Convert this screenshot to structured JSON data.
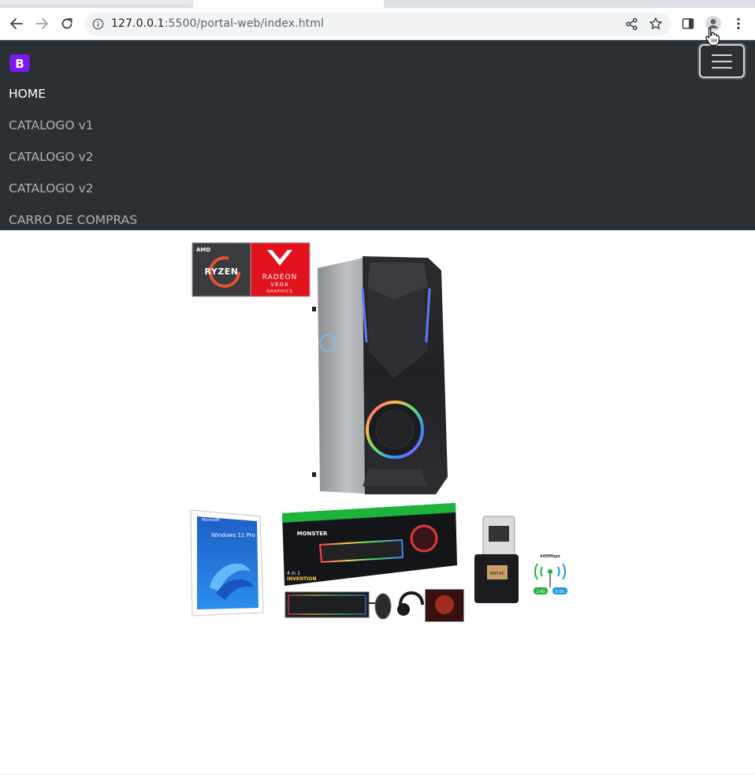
{
  "browser": {
    "url_host": "127.0.0.1",
    "url_path": ":5500/portal-web/index.html"
  },
  "navbar": {
    "brand_letter": "B",
    "items": [
      {
        "label": "HOME",
        "active": true
      },
      {
        "label": "CATALOGO v1",
        "active": false
      },
      {
        "label": "CATALOGO v2",
        "active": false
      },
      {
        "label": "CATALOGO v2",
        "active": false
      },
      {
        "label": "CARRO DE COMPRAS",
        "active": false
      }
    ]
  },
  "hero": {
    "badges": {
      "amd": "AMD",
      "ryzen": "RYZEN",
      "radeon": "RADEON",
      "vega": "VEGA",
      "graphics": "GRAPHICS"
    },
    "windows_label": "Windows 11 Pro",
    "microsoft_label": "Microsoft",
    "combo_brand": "MONSTER",
    "combo_subtitle": "4 in 1",
    "combo_sub2": "INVENTION",
    "wifi_speed": "600Mbps",
    "wifi_band1": "2.4G",
    "wifi_band2": "5.0G",
    "adapter_label": "WiFi AC"
  },
  "colors": {
    "navbar_bg": "#2b3035",
    "brand_purple": "#7e16f6",
    "amd_red": "#e2131d"
  }
}
